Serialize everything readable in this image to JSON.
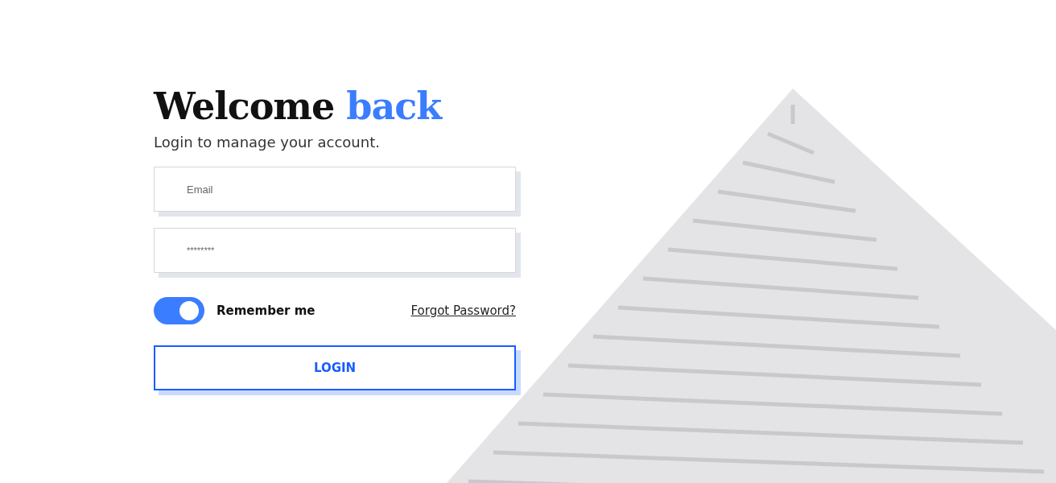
{
  "heading": {
    "text": "Welcome",
    "highlight": "back"
  },
  "subtitle": "Login to manage your account.",
  "fields": [
    {
      "kind": "email",
      "placeholder": "Email"
    },
    {
      "kind": "password",
      "placeholder": "********"
    }
  ],
  "remember": {
    "label": "Remember me",
    "on": true
  },
  "forgot_link": "Forgot Password?",
  "login_button": "LOGIN"
}
